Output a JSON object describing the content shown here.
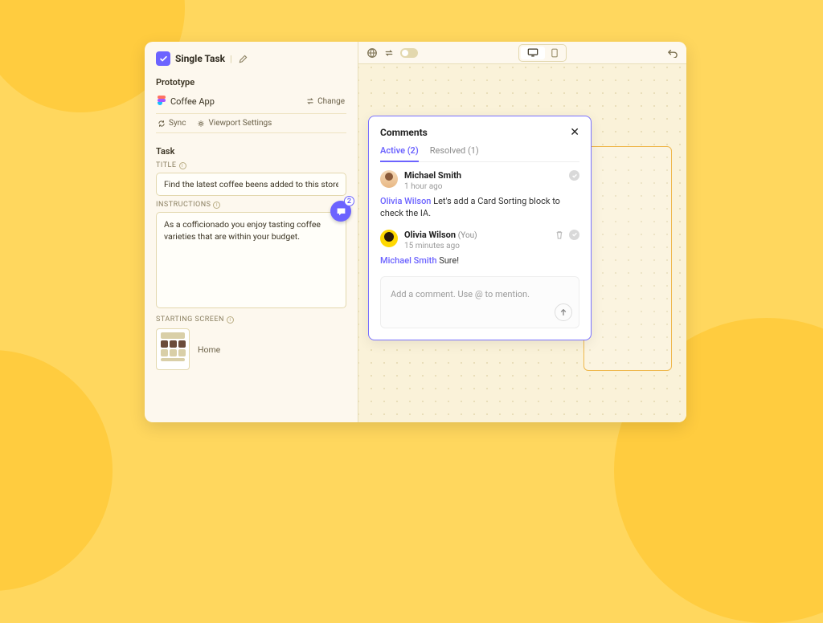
{
  "header": {
    "title": "Single Task"
  },
  "prototype": {
    "section_label": "Prototype",
    "name": "Coffee App",
    "change_label": "Change",
    "sync_label": "Sync",
    "viewport_label": "Viewport Settings"
  },
  "task": {
    "section_label": "Task",
    "title_label": "TITLE",
    "title_value": "Find the latest coffee beens added to this store that cost l",
    "instructions_label": "INSTRUCTIONS",
    "instructions_value": "As a cofficionado you enjoy tasting coffee varieties that are within your budget.",
    "comment_badge": "2",
    "starting_label": "STARTING SCREEN",
    "starting_screen": "Home"
  },
  "comments": {
    "title": "Comments",
    "tabs": {
      "active": "Active (2)",
      "resolved": "Resolved (1)"
    },
    "items": [
      {
        "name": "Michael Smith",
        "you": "",
        "time": "1 hour ago",
        "mention": "Olivia Wilson",
        "body": " Let's add a Card Sorting block to check the IA."
      },
      {
        "name": "Olivia Wilson",
        "you": "(You)",
        "time": "15 minutes ago",
        "mention": "Michael Smith",
        "body": " Sure!"
      }
    ],
    "placeholder": "Add a comment. Use @ to mention."
  },
  "colors": {
    "accent": "#6c63ff",
    "warn": "#efb84e"
  }
}
